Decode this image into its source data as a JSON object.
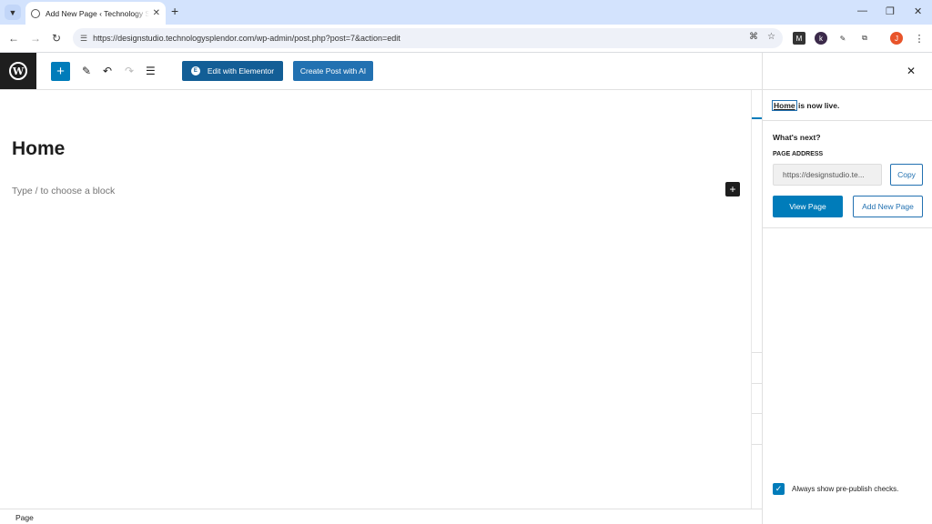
{
  "browser": {
    "tab_title": "Add New Page ‹ Technology Splendor",
    "url": "https://designstudio.technologysplendor.com/wp-admin/post.php?post=7&action=edit",
    "profile_initial": "J"
  },
  "toolbar": {
    "elementor_label": "Edit with Elementor",
    "ai_label": "Create Post with AI"
  },
  "editor": {
    "page_title": "Home",
    "block_placeholder": "Type / to choose a block"
  },
  "footer": {
    "breadcrumb": "Page"
  },
  "sidebar": {
    "live_link": "Home",
    "live_suffix": " is now live.",
    "whats_next": "What's next?",
    "page_address_label": "PAGE ADDRESS",
    "page_address_value": "https://designstudio.te...",
    "copy_label": "Copy",
    "view_page_label": "View Page",
    "add_new_page_label": "Add New Page",
    "prepublish_label": "Always show pre-publish checks.",
    "prepublish_checked": true
  },
  "colors": {
    "wp_blue": "#007cba",
    "elementor_blue": "#135e96",
    "tab_bar": "#d3e3fd",
    "dark": "#1e1e1e"
  }
}
